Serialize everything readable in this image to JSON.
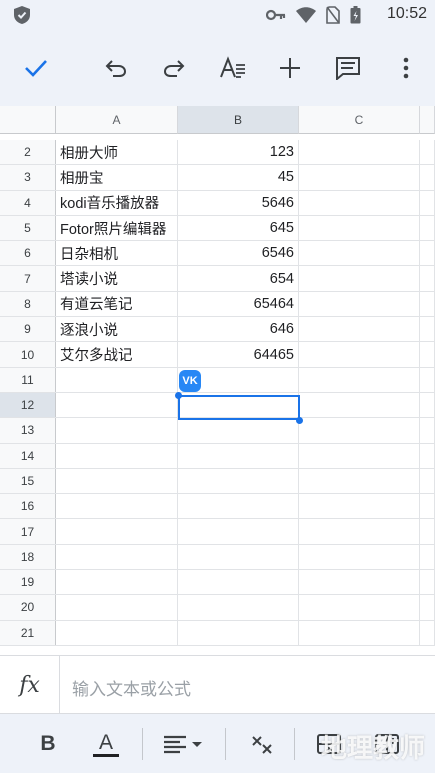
{
  "status_bar": {
    "time": "10:52"
  },
  "formula_bar": {
    "fx_label": "fx",
    "placeholder": "输入文本或公式"
  },
  "columns": [
    "A",
    "B",
    "C"
  ],
  "rows": [
    {
      "num": "2",
      "a": "相册大师",
      "b": "123"
    },
    {
      "num": "3",
      "a": "相册宝",
      "b": "45"
    },
    {
      "num": "4",
      "a": "kodi音乐播放器",
      "b": "5646"
    },
    {
      "num": "5",
      "a": "Fotor照片编辑器",
      "b": "645"
    },
    {
      "num": "6",
      "a": "日杂相机",
      "b": "6546"
    },
    {
      "num": "7",
      "a": "塔读小说",
      "b": "654"
    },
    {
      "num": "8",
      "a": "有道云笔记",
      "b": "65464"
    },
    {
      "num": "9",
      "a": "逐浪小说",
      "b": "646"
    },
    {
      "num": "10",
      "a": "艾尔多战记",
      "b": "64465"
    },
    {
      "num": "11",
      "a": "",
      "b": ""
    },
    {
      "num": "12",
      "a": "",
      "b": ""
    },
    {
      "num": "13",
      "a": "",
      "b": ""
    },
    {
      "num": "14",
      "a": "",
      "b": ""
    },
    {
      "num": "15",
      "a": "",
      "b": ""
    },
    {
      "num": "16",
      "a": "",
      "b": ""
    },
    {
      "num": "17",
      "a": "",
      "b": ""
    },
    {
      "num": "18",
      "a": "",
      "b": ""
    },
    {
      "num": "19",
      "a": "",
      "b": ""
    },
    {
      "num": "20",
      "a": "",
      "b": ""
    },
    {
      "num": "21",
      "a": "",
      "b": ""
    }
  ],
  "selected": {
    "column": "B",
    "row": "12"
  },
  "format_bar": {
    "bold_label": "B",
    "text_color_label": "A"
  },
  "watermark": "地理教师",
  "badge": "VK",
  "colors": {
    "accent": "#1a73e8",
    "toolbar_bg": "#eef2f9",
    "vk": "#2787f5"
  }
}
